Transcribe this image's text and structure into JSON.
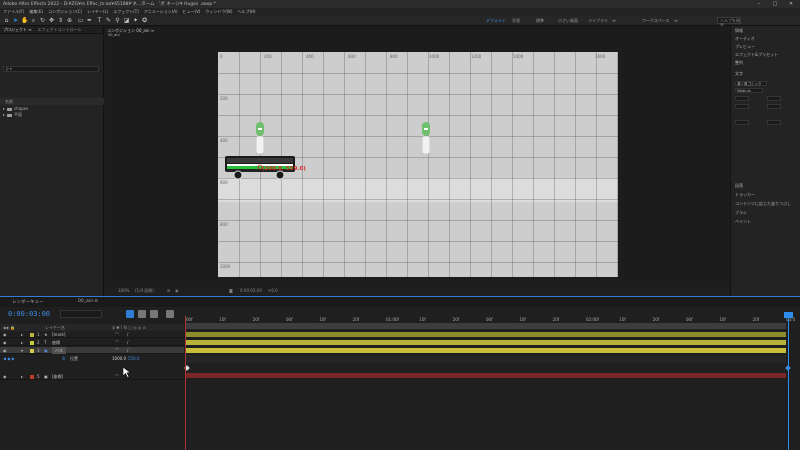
{
  "app": {
    "title": "Adobe After Effects 2022 - D:¥ZG¥m Effec_ts:ae¥45188¥'ネ...ターム　'ボ ネージ¥ Huges .aaep *",
    "win_controls": [
      "–",
      "□",
      "✕"
    ]
  },
  "menubar": {
    "items": [
      "ファイル(F)",
      "編集(E)",
      "コンポジション(C)",
      "レイヤー(L)",
      "エフェクト(T)",
      "アニメーション(A)",
      "ビュー(V)",
      "ウィンドウ(W)",
      "ヘルプ(H)"
    ]
  },
  "toolbar": {
    "workspaces": [
      "デフォルト",
      "学習",
      "標準",
      "小さい画面",
      "ライブラリ",
      "≫",
      "ワークスペース",
      "≫"
    ],
    "active_workspace": "デフォルト",
    "search_placeholder": "ヘルプを検索"
  },
  "left_panel": {
    "tabs": [
      "プロジェクト ≡",
      "エフェクトコントロール"
    ],
    "search_placeholder": "ρ ▾",
    "column_header": "名前",
    "rows": [
      {
        "label": "shapes"
      },
      {
        "label": "平面"
      }
    ]
  },
  "comp_panel": {
    "tab": "コンポジション 00_ani ≡",
    "subtab": "00_ani",
    "ruler_labels_x": [
      "0",
      "200",
      "400",
      "600",
      "800",
      "1000",
      "1200",
      "1400",
      "1600"
    ],
    "ruler_labels_y": [
      "200",
      "400",
      "600",
      "800",
      "1000"
    ],
    "coord_label": "(200.0, 559.0)",
    "footer": {
      "zoom": "100%",
      "quality": "(1/4 画質)",
      "timecode": "0:00:03:00",
      "extra": "+0.0"
    }
  },
  "right_panel": {
    "items": [
      "情報",
      "オーディオ",
      "プレビュー",
      "エフェクト&プリセット",
      "整列",
      "文字"
    ],
    "font": "源ノ角ゴシック",
    "font_style": "Medium",
    "lower_items": [
      "段落",
      "トラッカー",
      "コンテンツに応じた塗りつぶし",
      "ブラシ",
      "ペイント"
    ]
  },
  "timeline": {
    "tabs": [
      "レンダーキュー",
      "00_ani ≡"
    ],
    "timecode": "0:00:03:00",
    "col_headers": {
      "name": "レイヤー名",
      "switches": "♀ ✱ \\ fx ◻ ◎ ◎ ⊙"
    },
    "ruler_labels": [
      "00f",
      "10f",
      "20f",
      "00f",
      "10f",
      "20f",
      "01:00f",
      "10f",
      "20f",
      "00f",
      "10f",
      "20f",
      "02:00f",
      "10f",
      "20f",
      "00f",
      "10f",
      "20f",
      "03:0"
    ],
    "layers": [
      {
        "num": "1",
        "type": "★",
        "name": "[mark]",
        "color": "#b8b83a",
        "track_color": "#8c8c2a",
        "selected": false
      },
      {
        "num": "2",
        "type": "T",
        "name": "座標",
        "color": "#c9c944",
        "track_color": "#b8b23a",
        "selected": false
      },
      {
        "num": "3",
        "type": "▣",
        "name": "バス",
        "color": "#d8c84a",
        "track_color": "#c9bd3c",
        "selected": true
      },
      {
        "num": "5",
        "type": "▣",
        "name": "[座標]",
        "color": "#c0392b",
        "track_color": "#7a2626",
        "selected": false
      }
    ],
    "property": {
      "name": "位置",
      "value": "1000.0",
      "value2": "550.0"
    }
  }
}
